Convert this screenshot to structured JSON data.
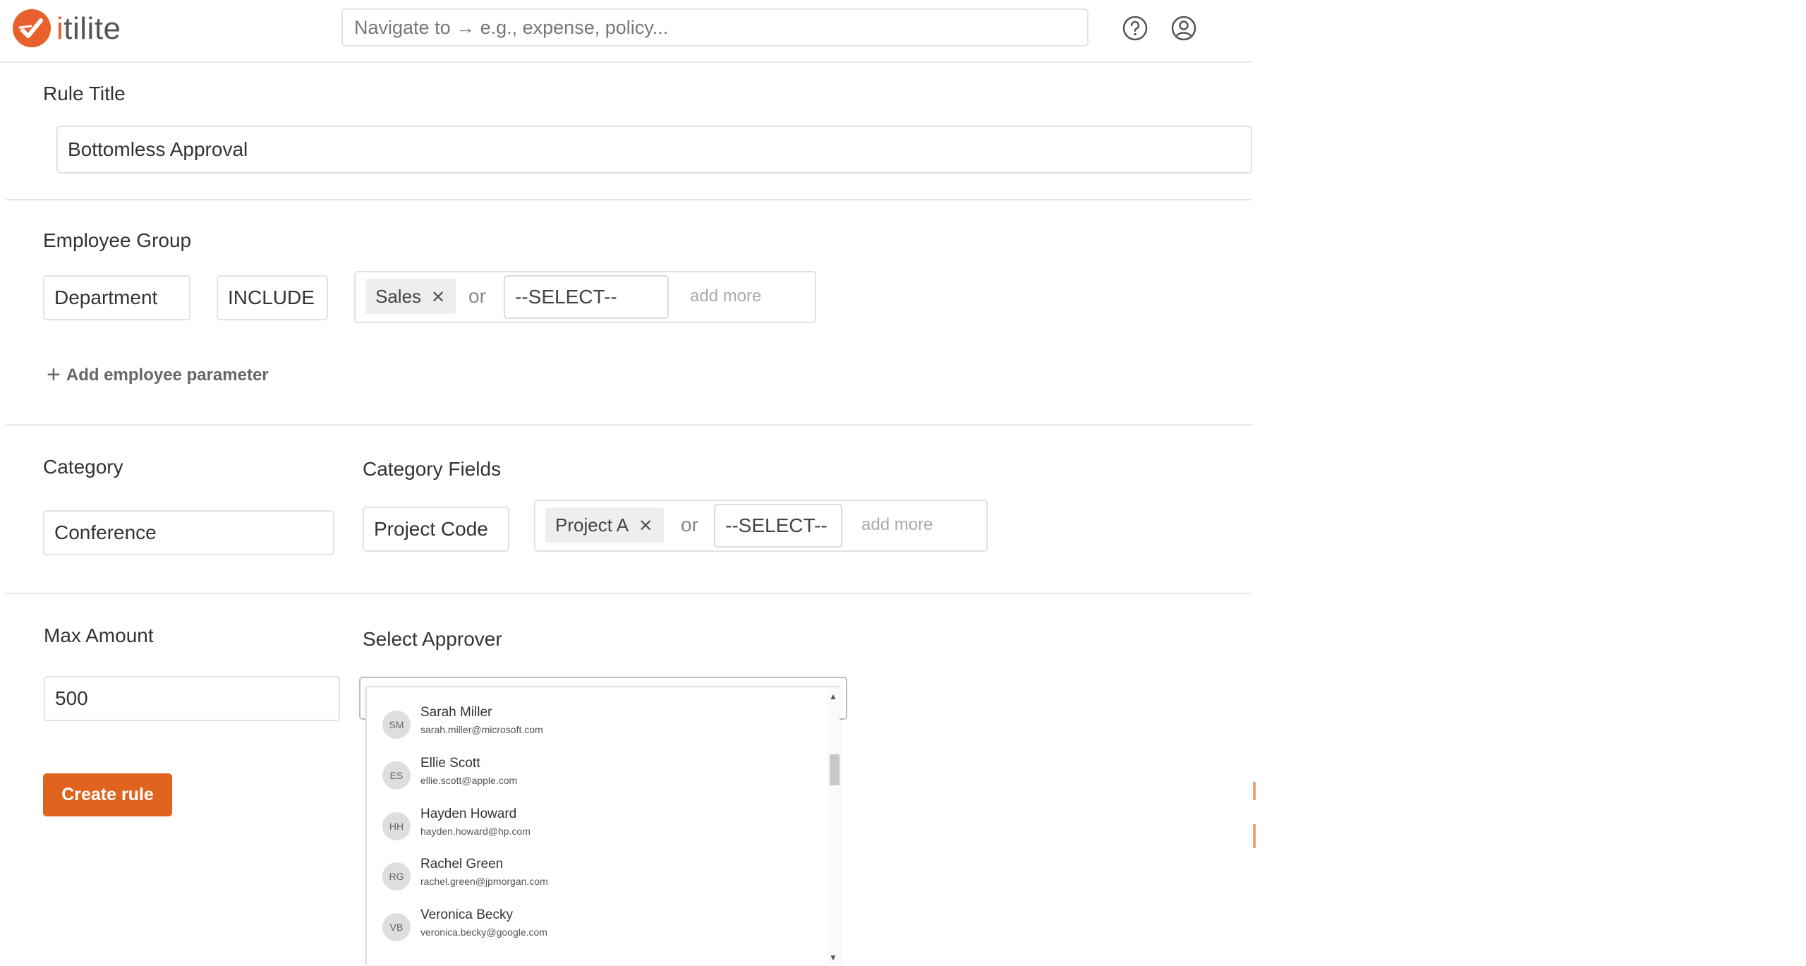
{
  "header": {
    "logo_text": "itilite",
    "search_placeholder": "Navigate to → e.g., expense, policy...",
    "help_icon": "help-circle-icon",
    "profile_icon": "user-circle-icon"
  },
  "rule_title": {
    "label": "Rule Title",
    "value": "Bottomless Approval"
  },
  "employee_group": {
    "label": "Employee Group",
    "parameter": "Department",
    "operator": "INCLUDE",
    "chips": [
      "Sales"
    ],
    "or_label": "or",
    "select_placeholder": "--SELECT--",
    "add_more": "add more",
    "add_parameter": "Add employee parameter"
  },
  "category": {
    "label": "Category",
    "value": "Conference"
  },
  "category_fields": {
    "label": "Category Fields",
    "field": "Project Code",
    "chips": [
      "Project A"
    ],
    "or_label": "or",
    "select_placeholder": "--SELECT--",
    "add_more": "add more"
  },
  "max_amount": {
    "label": "Max Amount",
    "value": "500"
  },
  "approver": {
    "label": "Select Approver",
    "options": [
      {
        "initials": "SM",
        "name": "Sarah Miller",
        "email": "sarah.miller@microsoft.com"
      },
      {
        "initials": "ES",
        "name": "Ellie Scott",
        "email": "ellie.scott@apple.com"
      },
      {
        "initials": "HH",
        "name": "Hayden Howard",
        "email": "hayden.howard@hp.com"
      },
      {
        "initials": "RG",
        "name": "Rachel Green",
        "email": "rachel.green@jpmorgan.com"
      },
      {
        "initials": "VB",
        "name": "Veronica Becky",
        "email": "veronica.becky@google.com"
      }
    ]
  },
  "actions": {
    "create_rule": "Create rule"
  },
  "colors": {
    "brand": "#e8602c",
    "button": "#e0641e"
  }
}
